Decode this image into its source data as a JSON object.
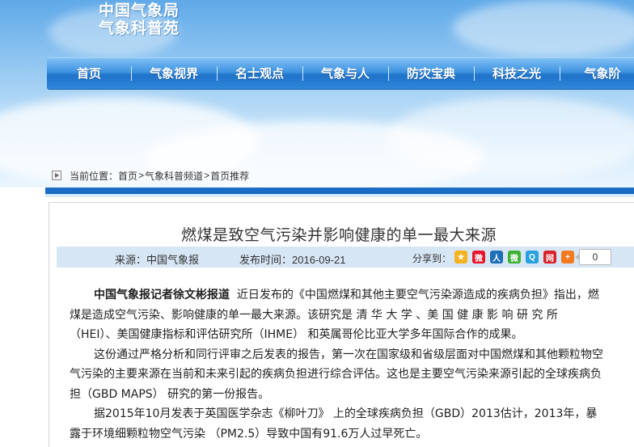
{
  "header": {
    "logo_line1": "中国气象局",
    "logo_line2": "气象科普苑"
  },
  "nav": {
    "items": [
      "首页",
      "气象视界",
      "名士观点",
      "气象与人",
      "防灾宝典",
      "科技之光",
      "气象阶"
    ]
  },
  "breadcrumb": {
    "prefix": "当前位置：",
    "items": [
      "首页",
      "气象科普频道",
      "首页推荐"
    ],
    "separator": ">"
  },
  "article": {
    "title": "燃煤是致空气污染并影响健康的单一最大来源",
    "source": "来源：中国气象报",
    "date": "发布时间：2016-09-21",
    "share_label": "分享到：",
    "share_count": "0",
    "lead": "中国气象报记者徐文彬报道",
    "paragraphs": [
      "近日发布的《中国燃煤和其他主要空气污染源造成的疾病负担》指出，燃煤是造成空气污染、影响健康的单一最大来源。该研究是 清 华 大 学 、美 国 健 康 影 响 研 究 所（HEI）、美国健康指标和评估研究所（IHME） 和英属哥伦比亚大学多年国际合作的成果。",
      "这份通过严格分析和同行评审之后发表的报告，第一次在国家级和省级层面对中国燃煤和其他颗粒物空气污染的主要来源在当前和未来引起的疾病负担进行综合评估。这也是主要空气污染来源引起的全球疾病负担（GBD MAPS） 研究的第一份报告。",
      "据2015年10月发表于英国医学杂志《柳叶刀》 上的全球疾病负担（GBD）2013估计，2013年，暴露于环境细颗粒物空气污染 （PM2.5）导致中国有91.6万人过早死亡。"
    ]
  },
  "share_icons": [
    {
      "name": "qzone-icon",
      "color": "#f5b21f",
      "glyph": "★"
    },
    {
      "name": "weibo-icon",
      "color": "#e6162d",
      "glyph": "微"
    },
    {
      "name": "renren-icon",
      "color": "#1d6fb8",
      "glyph": "人"
    },
    {
      "name": "wechat-icon",
      "color": "#3cb034",
      "glyph": "微"
    },
    {
      "name": "qq-icon",
      "color": "#2aa0e0",
      "glyph": "Q"
    },
    {
      "name": "netease-icon",
      "color": "#d8232a",
      "glyph": "网"
    },
    {
      "name": "more-icon",
      "color": "#f47a20",
      "glyph": "+"
    }
  ]
}
